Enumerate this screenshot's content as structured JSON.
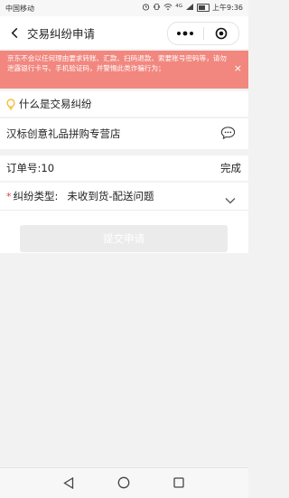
{
  "status_bar": {
    "carrier": "中国移动",
    "network": "4G",
    "time": "上午9:36"
  },
  "header": {
    "title": "交易纠纷申请"
  },
  "alert": {
    "message": "京东不会以任何理由要求转账、汇款、扫码退款、索要账号密码等，请勿泄露银行卡号、手机验证码，并警惕此类诈骗行为；",
    "close_label": "×"
  },
  "faq": {
    "label": "什么是交易纠纷"
  },
  "store": {
    "name": "汉标创意礼品拼购专营店"
  },
  "order": {
    "label": "订单号:10",
    "status": "完成"
  },
  "dispute": {
    "required_mark": "*",
    "label": "纠纷类型:",
    "value": "未收到货-配送问题"
  },
  "submit": {
    "label": "提交申请"
  },
  "colors": {
    "alert_bg": "#f1877f",
    "required": "#e4393c",
    "bulb": "#f5b41b",
    "submit_bg": "#ebebeb"
  }
}
